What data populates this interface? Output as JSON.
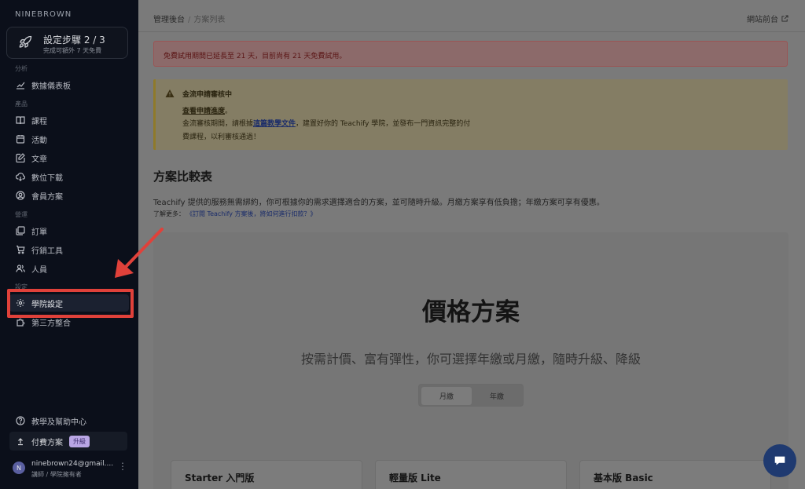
{
  "sidebar": {
    "brand": "NINEBROWN",
    "setup": {
      "title": "設定步驟 2 / 3",
      "subtitle": "完成可額外 7 天免費"
    },
    "sections": {
      "analytics": "分析",
      "products": "產品",
      "manage": "營運",
      "settings": "設定"
    },
    "items": {
      "dashboard": "數據儀表板",
      "courses": "課程",
      "events": "活動",
      "articles": "文章",
      "downloads": "數位下載",
      "membership": "會員方案",
      "orders": "訂單",
      "marketing": "行銷工具",
      "people": "人員",
      "school_settings": "學院設定",
      "integrations": "第三方整合",
      "help": "教學及幫助中心"
    },
    "plan": {
      "label": "付費方案",
      "badge": "升級"
    },
    "user": {
      "initial": "N",
      "email": "ninebrown24@gmail....",
      "role": "講師 / 學院擁有者"
    }
  },
  "header": {
    "breadcrumb_root": "管理後台",
    "breadcrumb_sep": "/",
    "breadcrumb_current": "方案列表",
    "site_link": "網站前台"
  },
  "alerts": {
    "trial": "免費試用期間已延長至 21 天，目前尚有 21 天免費試用。",
    "payment": {
      "title": "金流申請審核中",
      "check_link": "查看申請進度",
      "check_suffix": "。",
      "line2_prefix": "金流審核期間，請根據",
      "doc_link": "這篇教學文件",
      "line2_suffix": "，建置好你的 Teachify 學院，並發布一門資訊完整的付",
      "line3": "費課程，以利審核通過！"
    }
  },
  "comparison": {
    "title": "方案比較表",
    "desc": "Teachify 提供的服務無需綁約，你可根據你的需求選擇適合的方案，並可隨時升級。月繳方案享有低負擔；年繳方案可享有優惠。",
    "learn_prefix": "了解更多：",
    "learn_link": "《訂閱 Teachify 方案後，將如何進行扣款？》"
  },
  "pricing": {
    "title": "價格方案",
    "subtitle": "按需計價、富有彈性，你可選擇年繳或月繳，隨時升級、降級",
    "toggle": {
      "monthly": "月繳",
      "yearly": "年繳"
    },
    "plans": [
      "Starter 入門版",
      "輕量版 Lite",
      "基本版 Basic"
    ]
  },
  "colors": {
    "highlight": "#e0413a",
    "sidebar_bg": "#0b0f1a",
    "chat": "#1f3a70"
  },
  "icons": {
    "dashboard": "chart-icon",
    "courses": "book-icon",
    "events": "calendar-icon",
    "articles": "edit-icon",
    "downloads": "cloud-download-icon",
    "membership": "member-icon",
    "orders": "orders-icon",
    "marketing": "cart-icon",
    "people": "users-icon",
    "school_settings": "gear-icon",
    "integrations": "puzzle-icon",
    "help": "help-icon"
  }
}
